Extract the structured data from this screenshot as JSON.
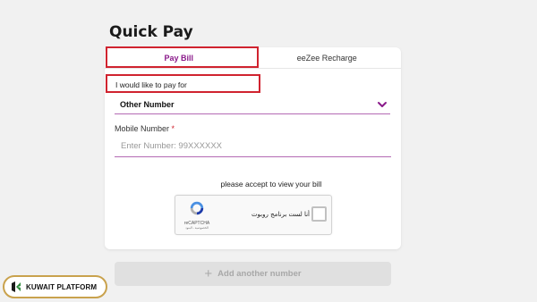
{
  "page": {
    "title": "Quick Pay"
  },
  "tabs": [
    {
      "label": "Pay Bill",
      "active": true
    },
    {
      "label": "eeZee Recharge",
      "active": false
    }
  ],
  "form": {
    "pay_for_label": "I would like to pay for",
    "pay_for_value": "Other Number",
    "mobile_label": "Mobile Number",
    "required_mark": "*",
    "mobile_placeholder": "Enter Number: 99XXXXXX",
    "mobile_value": "",
    "accept_text": "please accept to view your bill"
  },
  "captcha": {
    "label": "أنا لست برنامج روبوت",
    "brand": "reCAPTCHA",
    "terms": "الخصوصية - البنود"
  },
  "add_number": {
    "label": "Add another number"
  },
  "branding": {
    "name": "KUWAIT PLATFORM"
  },
  "colors": {
    "accent": "#8a1a8a",
    "highlight": "#d0232f",
    "brand_border": "#c9a24d"
  }
}
